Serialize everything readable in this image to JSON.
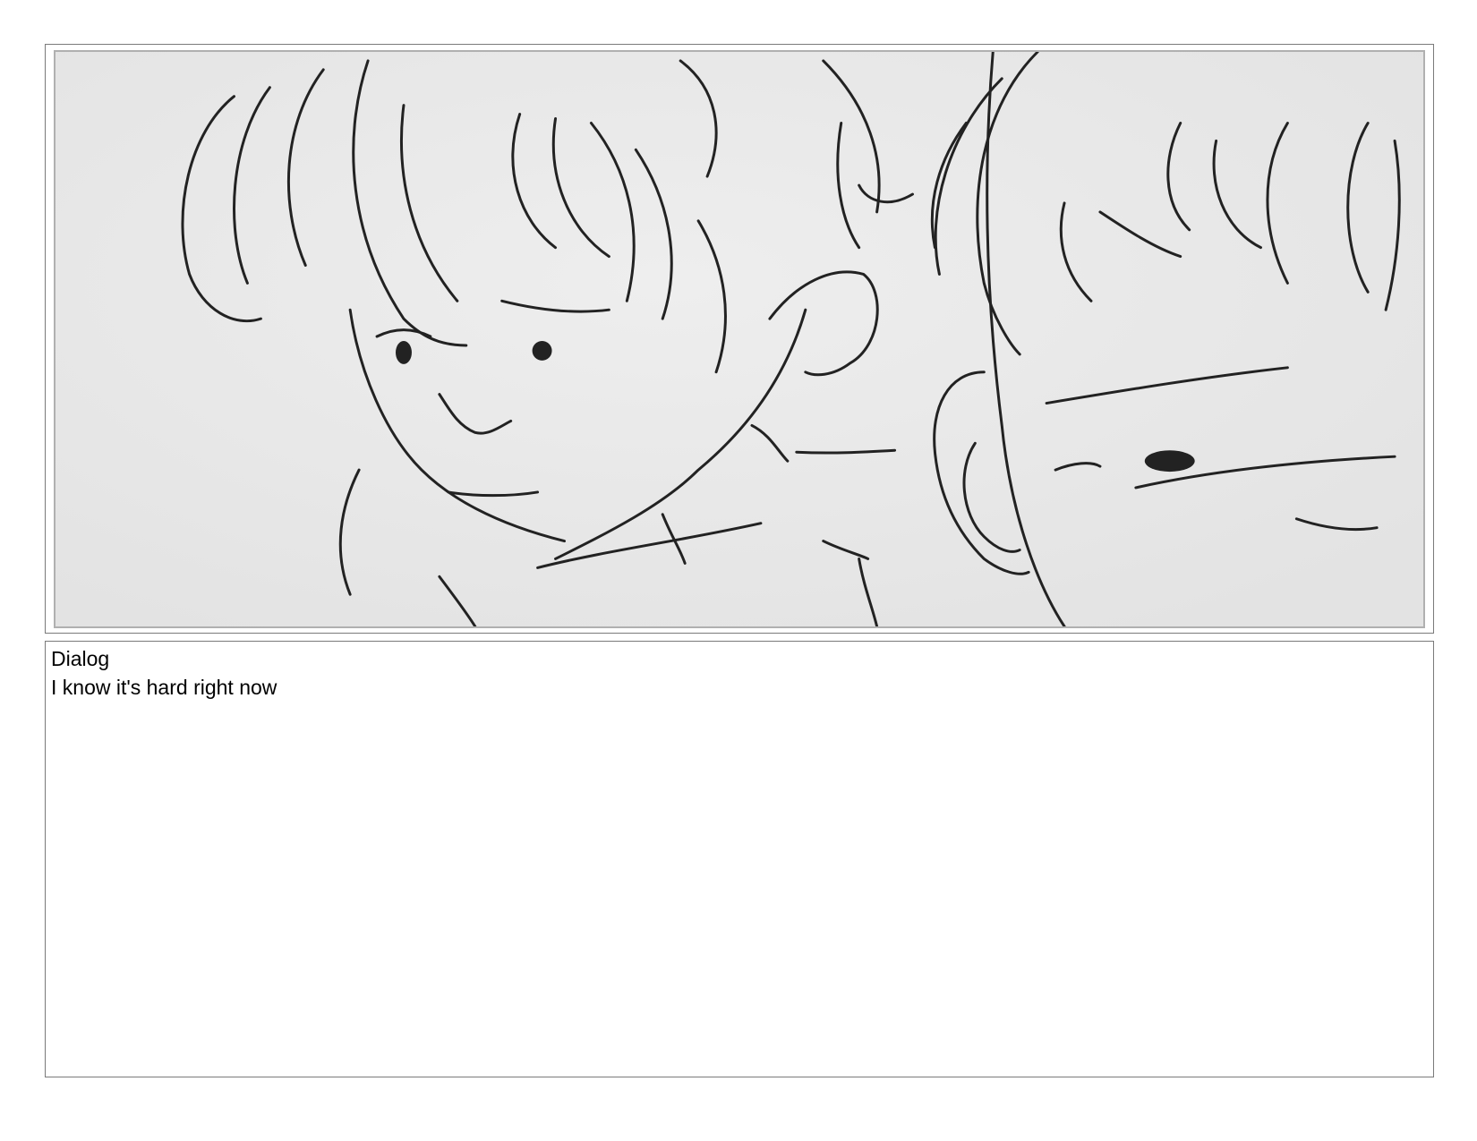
{
  "panel": {
    "image_subject": "storyboard-sketch-two-children"
  },
  "dialog": {
    "label": "Dialog",
    "text": "I know it's hard right now"
  },
  "colors": {
    "sketch_background": "#e9e9e9",
    "sketch_line": "#222222",
    "frame_border": "#7a7a7a"
  }
}
